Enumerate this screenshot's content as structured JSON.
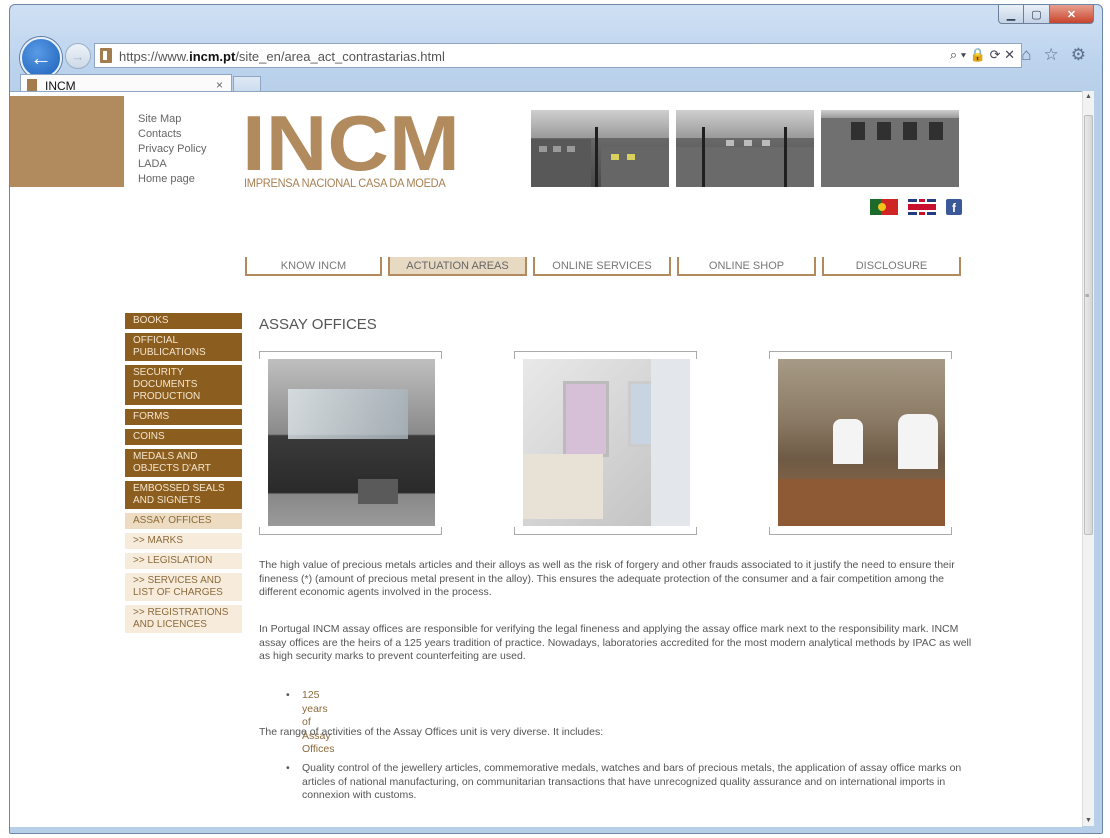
{
  "browser": {
    "url_prefix": "https://www.",
    "url_domain": "incm.pt",
    "url_path": "/site_en/area_act_contrastarias.html",
    "tab_title": "INCM",
    "tab_close": "×",
    "address_icons": "⌕ ▾ 🔒 ⟳ ✕"
  },
  "site": {
    "top_links": [
      "Site Map",
      "Contacts",
      "Privacy Policy",
      "LADA",
      "Home page"
    ],
    "logo_text": "INCM",
    "logo_subtitle": "IMPRENSA NACIONAL CASA DA MOEDA",
    "facebook": "f"
  },
  "topnav": [
    {
      "label": "KNOW INCM",
      "active": false
    },
    {
      "label": "ACTUATION AREAS",
      "active": true
    },
    {
      "label": "ONLINE SERVICES",
      "active": false
    },
    {
      "label": "ONLINE SHOP",
      "active": false
    },
    {
      "label": "DISCLOSURE",
      "active": false
    }
  ],
  "sidenav": [
    {
      "label": "BOOKS",
      "state": "normal"
    },
    {
      "label": "OFFICIAL PUBLICATIONS",
      "state": "normal"
    },
    {
      "label": "SECURITY DOCUMENTS PRODUCTION",
      "state": "normal"
    },
    {
      "label": "FORMS",
      "state": "normal"
    },
    {
      "label": "COINS",
      "state": "normal"
    },
    {
      "label": "MEDALS AND OBJECTS D'ART",
      "state": "normal"
    },
    {
      "label": "EMBOSSED SEALS AND SIGNETS",
      "state": "normal"
    },
    {
      "label": "ASSAY OFFICES",
      "state": "active"
    },
    {
      "label": ">> MARKS",
      "state": "sub"
    },
    {
      "label": ">> LEGISLATION",
      "state": "sub"
    },
    {
      "label": ">> SERVICES AND LIST OF CHARGES",
      "state": "sub"
    },
    {
      "label": ">> REGISTRATIONS AND LICENCES",
      "state": "sub"
    }
  ],
  "main": {
    "title": "ASSAY OFFICES",
    "para1": "The high value of precious metals articles and their alloys as well as the risk of forgery and other frauds associated to it justify the need to ensure their fineness (*) (amount of precious metal present in the alloy). This ensures the adequate protection of the consumer and a fair competition among the different economic agents involved in the process.",
    "para2": "In Portugal INCM assay offices are responsible for verifying the legal fineness and applying the assay office mark next to the responsibility mark. INCM assay offices are the heirs of a 125 years tradition of practice. Nowadays, laboratories accredited for the most modern analytical methods by IPAC as well as high security marks to prevent counterfeiting are used.",
    "link1": "125 years of Assay Offices",
    "para3": "The range of activities of the Assay Offices unit is very diverse. It includes:",
    "bullet1": "Quality control of the jewellery articles, commemorative medals, watches and bars of precious metals, the application of assay office marks on articles of national manufacturing, on communitarian transactions that have unrecognized quality assurance and on international imports in connexion with customs.",
    "bullet_char": "•"
  }
}
